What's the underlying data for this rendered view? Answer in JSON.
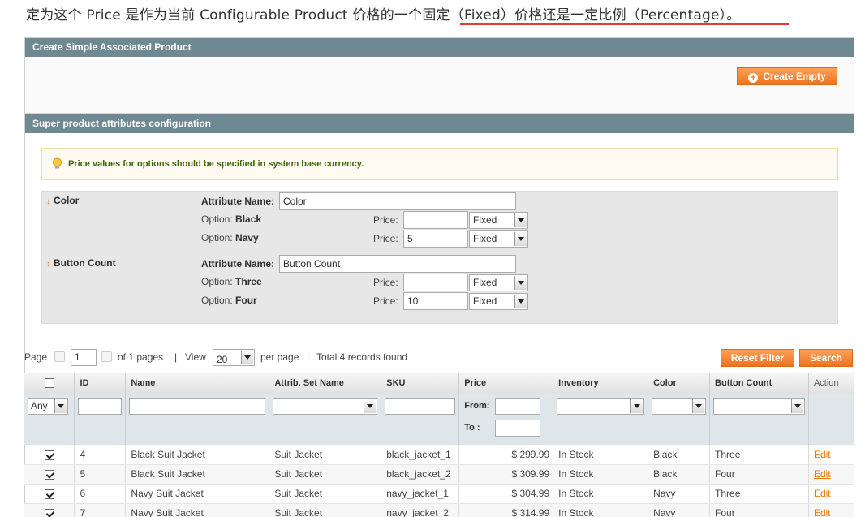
{
  "intro": {
    "text_before": "定为这个 Price 是作为当前 Configurable Product 价格的一个固",
    "text_highlight": "定（Fixed）价格还是一定比例（Percentage）。"
  },
  "create_simple": {
    "title": "Create Simple Associated Product",
    "create_empty_label": "Create Empty"
  },
  "super_attrs": {
    "title": "Super product attributes configuration",
    "notice": "Price values for options should be specified in system base currency.",
    "attributes": [
      {
        "title": "Color",
        "name_label": "Attribute Name:",
        "name_value": "Color",
        "options": [
          {
            "label": "Option:",
            "value": "Black",
            "price_label": "Price:",
            "price": "",
            "type": "Fixed"
          },
          {
            "label": "Option:",
            "value": "Navy",
            "price_label": "Price:",
            "price": "5",
            "type": "Fixed"
          }
        ]
      },
      {
        "title": "Button Count",
        "name_label": "Attribute Name:",
        "name_value": "Button Count",
        "options": [
          {
            "label": "Option:",
            "value": "Three",
            "price_label": "Price:",
            "price": "",
            "type": "Fixed"
          },
          {
            "label": "Option:",
            "value": "Four",
            "price_label": "Price:",
            "price": "10",
            "type": "Fixed"
          }
        ]
      }
    ]
  },
  "pager": {
    "page_label": "Page",
    "page_value": "1",
    "of_pages": "of 1 pages",
    "sep1": "|",
    "view_label": "View",
    "view_value": "20",
    "per_page": "per page",
    "sep2": "|",
    "total": "Total 4 records found",
    "reset_filter": "Reset Filter",
    "search": "Search"
  },
  "grid": {
    "columns": [
      "",
      "ID",
      "Name",
      "Attrib. Set Name",
      "SKU",
      "Price",
      "Inventory",
      "Color",
      "Button Count",
      "Action"
    ],
    "filter": {
      "any_value": "Any",
      "price_from": "From:",
      "price_to": "To :"
    },
    "rows": [
      {
        "checked": true,
        "id": "4",
        "name": "Black Suit Jacket",
        "set": "Suit Jacket",
        "sku": "black_jacket_1",
        "price": "$ 299.99",
        "inventory": "In Stock",
        "color": "Black",
        "buttons": "Three",
        "action": "Edit"
      },
      {
        "checked": true,
        "id": "5",
        "name": "Black Suit Jacket",
        "set": "Suit Jacket",
        "sku": "black_jacket_2",
        "price": "$ 309.99",
        "inventory": "In Stock",
        "color": "Black",
        "buttons": "Four",
        "action": "Edit"
      },
      {
        "checked": true,
        "id": "6",
        "name": "Navy Suit Jacket",
        "set": "Suit Jacket",
        "sku": "navy_jacket_1",
        "price": "$ 304.99",
        "inventory": "In Stock",
        "color": "Navy",
        "buttons": "Three",
        "action": "Edit"
      },
      {
        "checked": true,
        "id": "7",
        "name": "Navy Suit Jacket",
        "set": "Suit Jacket",
        "sku": "navy_jacket_2",
        "price": "$ 314.99",
        "inventory": "In Stock",
        "color": "Navy",
        "buttons": "Four",
        "action": "Edit"
      }
    ]
  },
  "colors": {
    "header_bg": "#6f8992",
    "accent_orange": "#f0731d",
    "notice_text": "#3d6611",
    "highlight_underline": "#e53935"
  }
}
